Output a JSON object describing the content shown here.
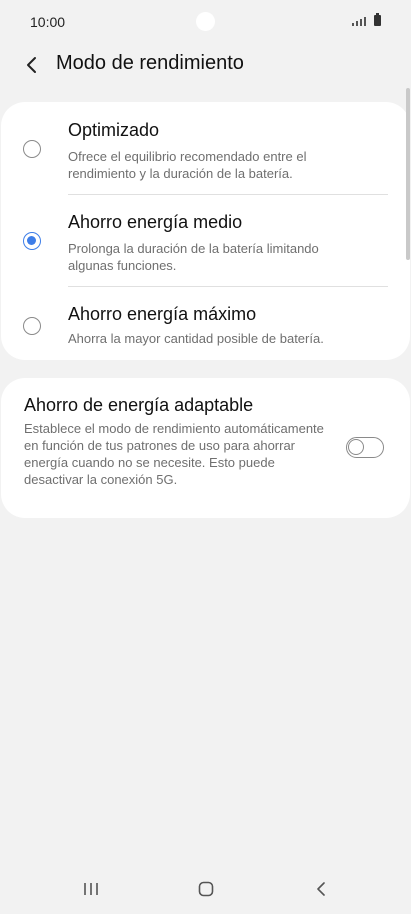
{
  "status_bar": {
    "time": "10:00"
  },
  "header": {
    "title": "Modo de rendimiento"
  },
  "options": [
    {
      "title": "Optimizado",
      "description": "Ofrece el equilibrio recomendado entre el rendimiento y la duración de la batería.",
      "selected": false
    },
    {
      "title": "Ahorro energía medio",
      "description": "Prolonga la duración de la batería limitando algunas funciones.",
      "selected": true
    },
    {
      "title": "Ahorro energía máximo",
      "description": "Ahorra la mayor cantidad posible de batería.",
      "selected": false
    }
  ],
  "adaptive": {
    "title": "Ahorro de energía adaptable",
    "description": "Establece el modo de rendimiento automáticamente en función de tus patrones de uso para ahorrar energía cuando no se necesite. Esto puede desactivar la conexión 5G.",
    "enabled": false
  },
  "colors": {
    "accent": "#3e7ee8",
    "background": "#f2f2f2",
    "card": "#ffffff"
  },
  "icons": {
    "back": "chevron-left-icon",
    "nav_recents": "recents-icon",
    "nav_home": "home-icon",
    "nav_back": "back-icon"
  }
}
